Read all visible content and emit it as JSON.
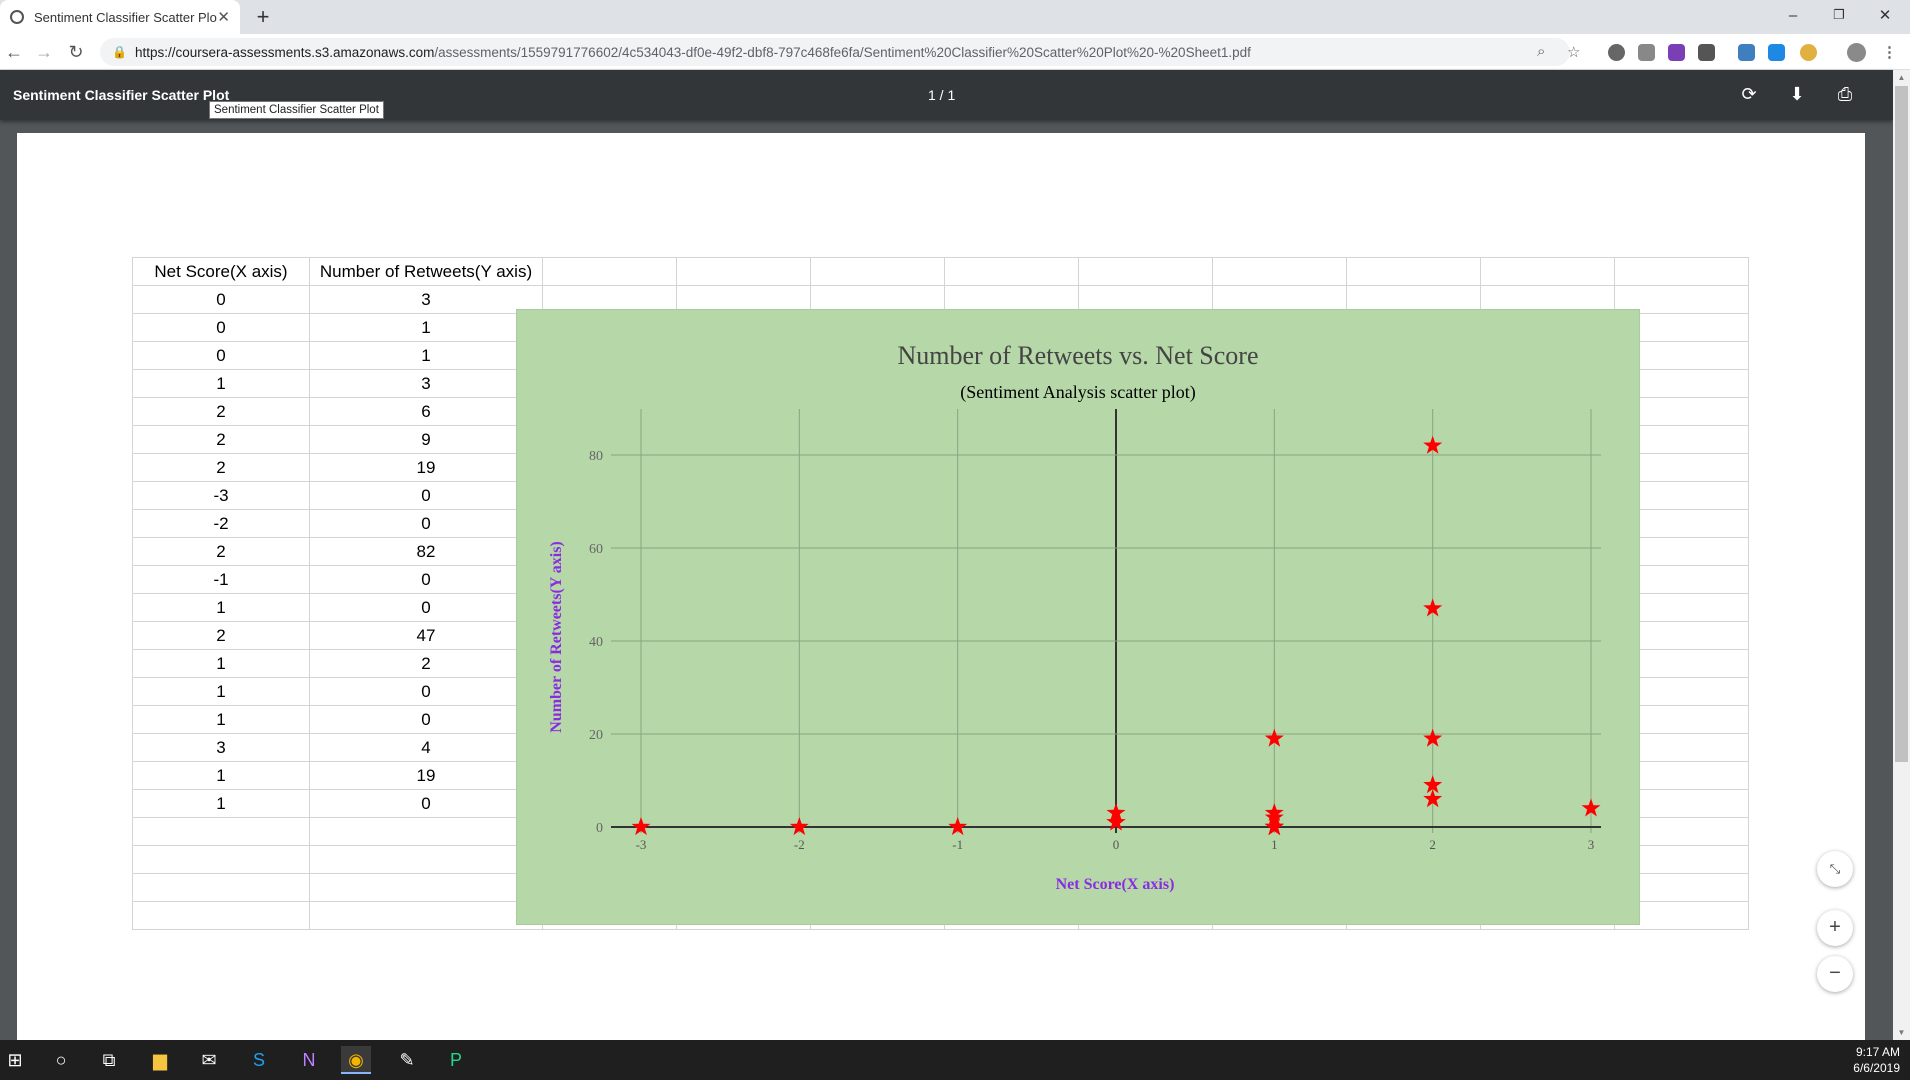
{
  "browser": {
    "tab_title": "Sentiment Classifier Scatter Plot",
    "tab_close": "✕",
    "new_tab": "+",
    "url_main": "https://coursera-assessments.s3.amazonaws.com",
    "url_path": "/assessments/1559791776602/4c534043-df0e-49f2-dbf8-797c468fe6fa/Sentiment%20Classifier%20Scatter%20Plot%20-%20Sheet1.pdf",
    "window_controls": [
      "–",
      "❐",
      "✕"
    ]
  },
  "pdf_viewer": {
    "title": "Sentiment Classifier Scatter Plot",
    "page_count": "1 / 1",
    "tooltip": "Sentiment Classifier Scatter Plot"
  },
  "sheet": {
    "headers": [
      "Net Score(X axis)",
      "Number of Retweets(Y axis)"
    ],
    "rows": [
      [
        "0",
        "3"
      ],
      [
        "0",
        "1"
      ],
      [
        "0",
        "1"
      ],
      [
        "1",
        "3"
      ],
      [
        "2",
        "6"
      ],
      [
        "2",
        "9"
      ],
      [
        "2",
        "19"
      ],
      [
        "-3",
        "0"
      ],
      [
        "-2",
        "0"
      ],
      [
        "2",
        "82"
      ],
      [
        "-1",
        "0"
      ],
      [
        "1",
        "0"
      ],
      [
        "2",
        "47"
      ],
      [
        "1",
        "2"
      ],
      [
        "1",
        "0"
      ],
      [
        "1",
        "0"
      ],
      [
        "3",
        "4"
      ],
      [
        "1",
        "19"
      ],
      [
        "1",
        "0"
      ]
    ]
  },
  "chart_data": {
    "type": "scatter",
    "title": "Number of Retweets vs. Net Score",
    "subtitle": "(Sentiment Analysis scatter plot)",
    "xlabel": "Net Score(X axis)",
    "ylabel": "Number of Retweets(Y axis)",
    "xlim": [
      -3,
      3
    ],
    "ylim": [
      0,
      85
    ],
    "xticks": [
      -3,
      -2,
      -1,
      0,
      1,
      2,
      3
    ],
    "yticks": [
      0,
      20,
      40,
      60,
      80
    ],
    "grid": true,
    "marker": "star",
    "marker_color": "#ff0000",
    "background": "#b6d7a8",
    "points": [
      {
        "x": 0,
        "y": 3
      },
      {
        "x": 0,
        "y": 1
      },
      {
        "x": 0,
        "y": 1
      },
      {
        "x": 1,
        "y": 3
      },
      {
        "x": 2,
        "y": 6
      },
      {
        "x": 2,
        "y": 9
      },
      {
        "x": 2,
        "y": 19
      },
      {
        "x": -3,
        "y": 0
      },
      {
        "x": -2,
        "y": 0
      },
      {
        "x": 2,
        "y": 82
      },
      {
        "x": -1,
        "y": 0
      },
      {
        "x": 1,
        "y": 0
      },
      {
        "x": 2,
        "y": 47
      },
      {
        "x": 1,
        "y": 2
      },
      {
        "x": 1,
        "y": 0
      },
      {
        "x": 1,
        "y": 0
      },
      {
        "x": 3,
        "y": 4
      },
      {
        "x": 1,
        "y": 19
      },
      {
        "x": 1,
        "y": 0
      }
    ]
  },
  "taskbar": {
    "time": "9:17 AM",
    "date": "6/6/2019"
  }
}
